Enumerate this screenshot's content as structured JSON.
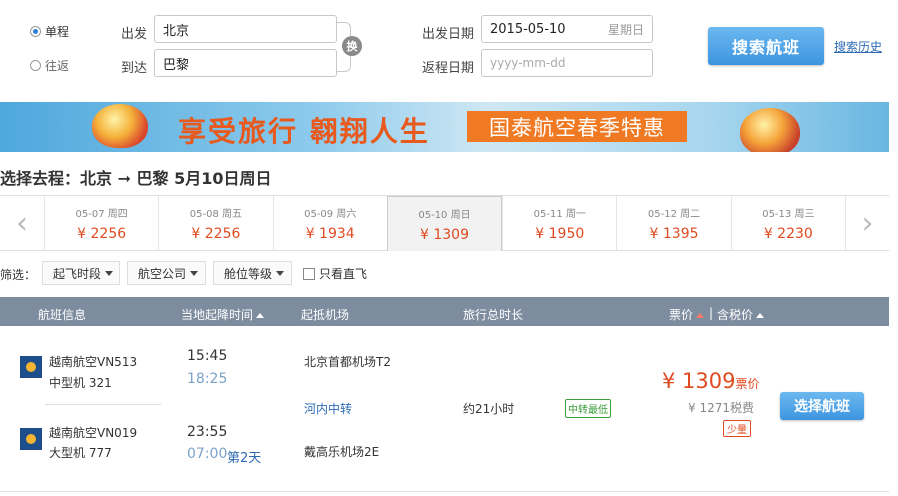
{
  "search": {
    "trip_types": [
      "单程",
      "往返"
    ],
    "depart_label": "出发",
    "arrive_label": "到达",
    "depart_city": "北京",
    "arrive_city": "巴黎",
    "swap_label": "换",
    "depart_date_label": "出发日期",
    "depart_date": "2015-05-10",
    "depart_weekday": "星期日",
    "return_date_label": "返程日期",
    "return_placeholder": "yyyy-mm-dd",
    "search_button": "搜索航班",
    "history_link": "搜索历史"
  },
  "banner": {
    "slogan": "享受旅行 翱翔人生",
    "tag": "国泰航空春季特惠"
  },
  "route_title": "选择去程：北京 ➞ 巴黎  5月10日周日",
  "dates": [
    {
      "date": "05-07 周四",
      "price": "¥ 2256"
    },
    {
      "date": "05-08 周五",
      "price": "¥ 2256"
    },
    {
      "date": "05-09 周六",
      "price": "¥ 1934"
    },
    {
      "date": "05-10 周日",
      "price": "¥ 1309"
    },
    {
      "date": "05-11 周一",
      "price": "¥ 1950"
    },
    {
      "date": "05-12 周二",
      "price": "¥ 1395"
    },
    {
      "date": "05-13 周三",
      "price": "¥ 2230"
    }
  ],
  "filter": {
    "label": "筛选：",
    "depart_time": "起飞时段",
    "airline": "航空公司",
    "cabin": "舱位等级",
    "direct_only": "只看直飞"
  },
  "table_header": {
    "flight_info": "航班信息",
    "local_time": "当地起降时间",
    "airports": "起抵机场",
    "duration": "旅行总时长",
    "price": "票价",
    "separator": "|",
    "tax_price": "含税价"
  },
  "flight": {
    "leg1": {
      "airline": "越南航空VN513",
      "plane": "中型机 321",
      "dep_time": "15:45",
      "arr_time": "18:25",
      "dep_airport": "北京首都机场T2"
    },
    "transfer": "河内中转",
    "leg2": {
      "airline": "越南航空VN019",
      "plane": "大型机 777",
      "dep_time": "23:55",
      "arr_time": "07:00",
      "next_day": "第2天",
      "arr_airport": "戴高乐机场2E"
    },
    "duration": "约21小时",
    "tag": "中转最低",
    "price": "¥ 1309",
    "price_suffix": "票价",
    "tax_price": "¥ 1271",
    "tax_suffix": "税费",
    "stock": "少量",
    "select_button": "选择航班"
  }
}
